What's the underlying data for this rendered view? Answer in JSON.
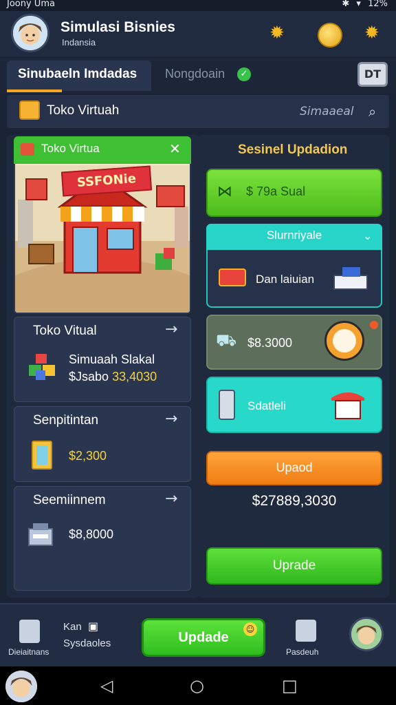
{
  "status_bar": {
    "left": "Joony Uma",
    "right": "12%"
  },
  "header": {
    "title": "Simulasi Bisnies",
    "subtitle": "Indansia"
  },
  "tabs": [
    {
      "label": "Sinubaeln Imdadas",
      "active": true
    },
    {
      "label": "Nongdoain",
      "active": false
    }
  ],
  "top_right_button": "DT",
  "store_bar": {
    "label": "Toko Virtuah",
    "search_placeholder": "Simaaeal"
  },
  "left": {
    "virtual_card": {
      "title": "Toko Virtua",
      "sign": "SSFONie"
    },
    "cards": [
      {
        "title": "Toko Vitual",
        "line1": "Simuaah Slakal",
        "line2_prefix": "$Jsabo",
        "line2_value": "33,4030"
      },
      {
        "title": "Senpitintan",
        "value": "$2,300"
      },
      {
        "title": "Seemiinnem",
        "value": "$8,8000"
      }
    ]
  },
  "right": {
    "title": "Sesinel Updadion",
    "green_card": "$ 79a Sual",
    "cyan_card": {
      "header": "Slurnriyale",
      "label": "Dan laiuian"
    },
    "olive_card": {
      "value": "$8.3000"
    },
    "teal_card": {
      "label": "Sdatleli"
    },
    "orange_button": "Upaod",
    "total": "$27889,3030",
    "green_button": "Uprade"
  },
  "bottom_nav": {
    "item1": "Dieiaitnans",
    "item2_line1": "Kan",
    "item2_line2": "Sysdaoles",
    "update_button": "Updade",
    "item4": "Pasdeuh"
  },
  "colors": {
    "accent_green": "#4cbc1c",
    "accent_orange": "#f07d12",
    "accent_cyan": "#27d4c8",
    "title_yellow": "#f5c84a",
    "bg": "#1b2436"
  }
}
